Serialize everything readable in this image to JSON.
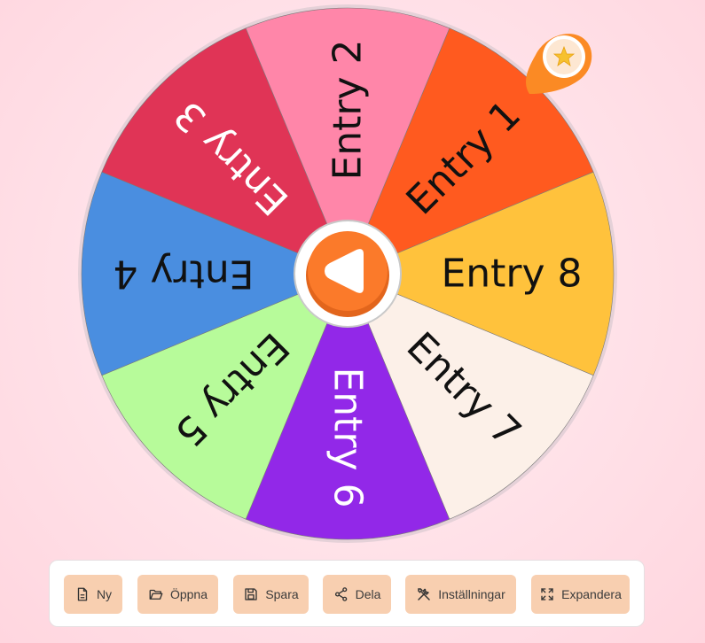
{
  "wheel": {
    "entries": [
      {
        "label": "Entry 1",
        "color": "#ff5a1f",
        "text_color": "#111111"
      },
      {
        "label": "Entry 8",
        "color": "#ffc23c",
        "text_color": "#111111"
      },
      {
        "label": "Entry 7",
        "color": "#fcf0e8",
        "text_color": "#111111"
      },
      {
        "label": "Entry 6",
        "color": "#9228e8",
        "text_color": "#ffffff"
      },
      {
        "label": "Entry 5",
        "color": "#b7fb9a",
        "text_color": "#111111"
      },
      {
        "label": "Entry 4",
        "color": "#4a8ee0",
        "text_color": "#111111"
      },
      {
        "label": "Entry 3",
        "color": "#e03456",
        "text_color": "#ffffff"
      },
      {
        "label": "Entry 2",
        "color": "#ff86a9",
        "text_color": "#111111"
      }
    ],
    "spin_button_icon": "play-icon",
    "pointer_icon": "star-icon",
    "accent_color": "#fb7a2a"
  },
  "toolbar": {
    "buttons": [
      {
        "label": "Ny",
        "icon": "new-file-icon"
      },
      {
        "label": "Öppna",
        "icon": "folder-open-icon"
      },
      {
        "label": "Spara",
        "icon": "save-icon"
      },
      {
        "label": "Dela",
        "icon": "share-icon"
      },
      {
        "label": "Inställningar",
        "icon": "settings-tools-icon"
      },
      {
        "label": "Expandera",
        "icon": "expand-icon"
      }
    ]
  }
}
